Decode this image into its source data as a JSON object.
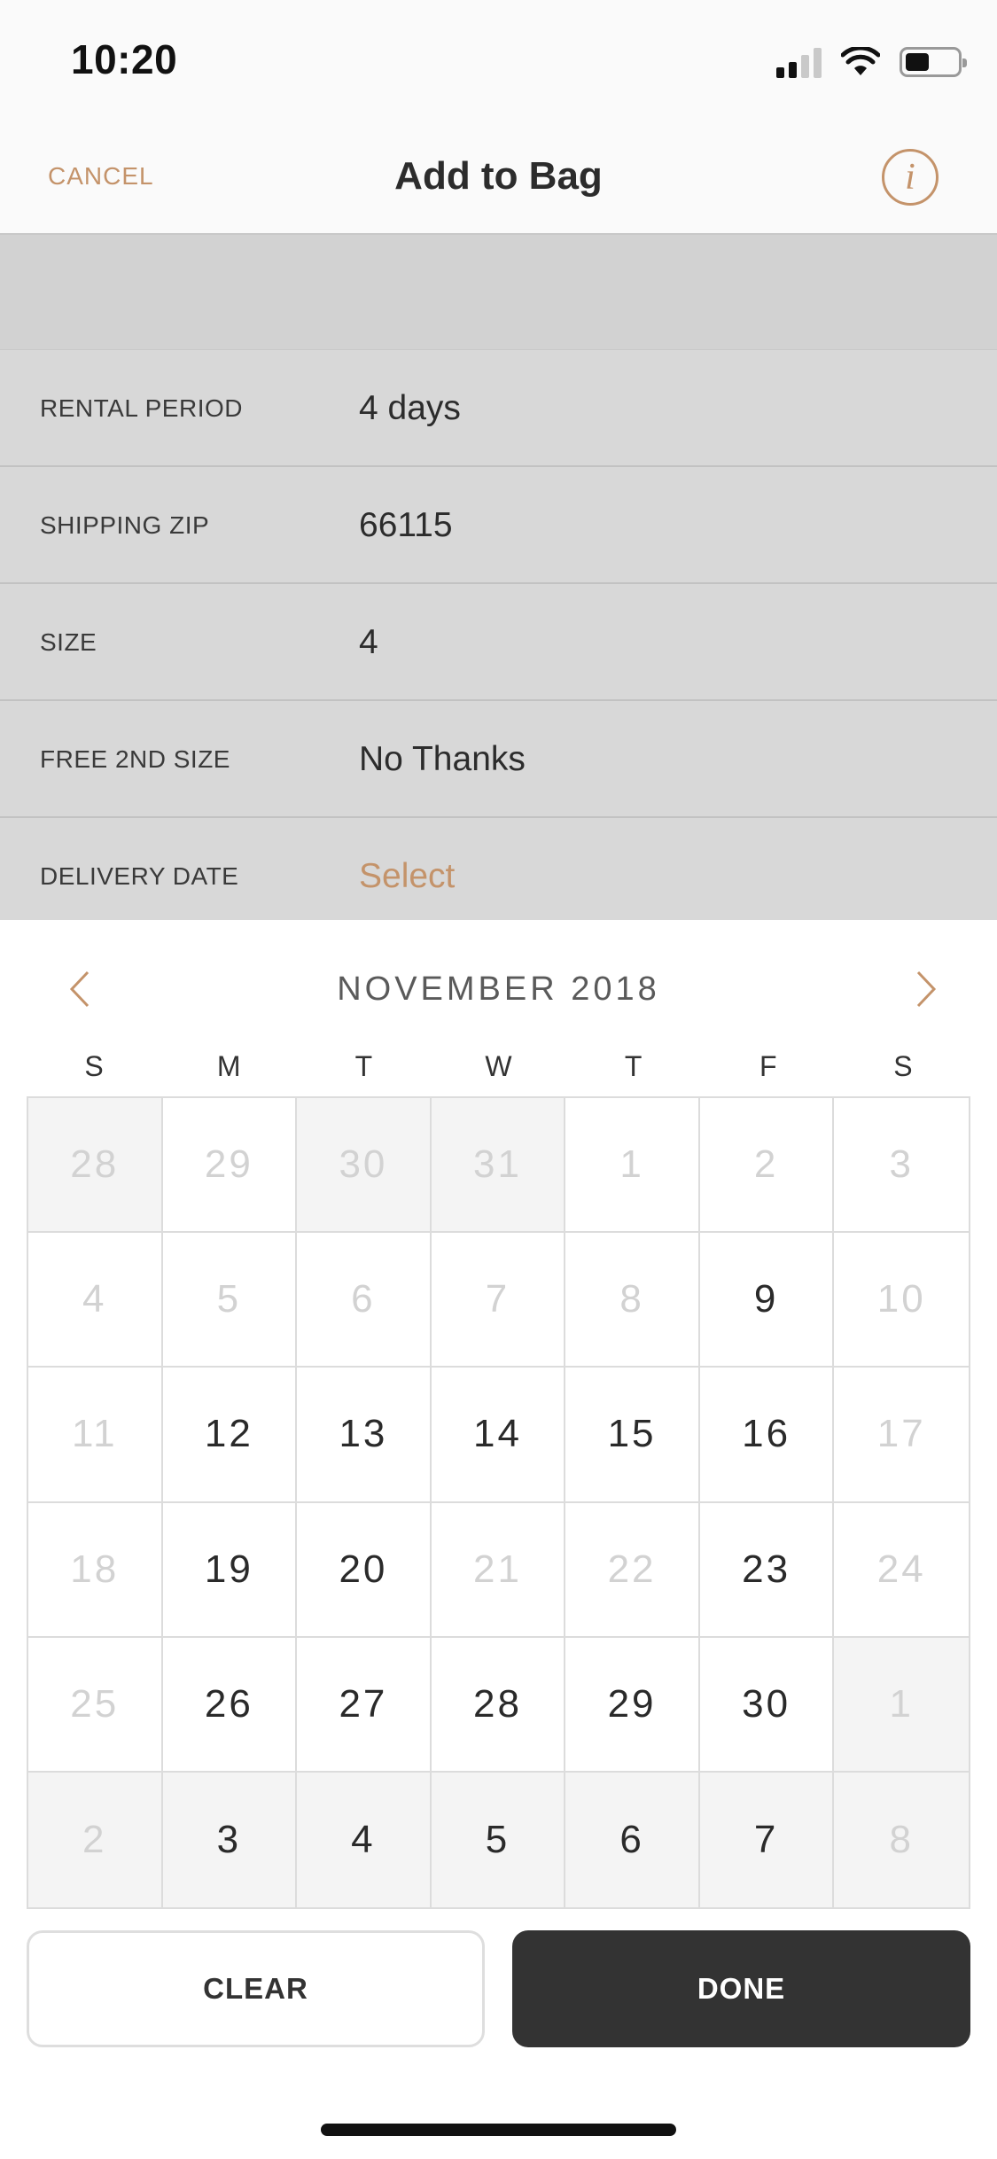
{
  "status_bar": {
    "time": "10:20",
    "battery_level": 0.45
  },
  "nav": {
    "cancel_label": "CANCEL",
    "title": "Add to Bag",
    "info_icon": "info-icon"
  },
  "options": [
    {
      "label": "RENTAL PERIOD",
      "value": "4 days"
    },
    {
      "label": "SHIPPING ZIP",
      "value": "66115"
    },
    {
      "label": "SIZE",
      "value": "4"
    },
    {
      "label": "FREE 2ND SIZE",
      "value": "No Thanks"
    },
    {
      "label": "DELIVERY DATE",
      "value": "Select"
    }
  ],
  "calendar": {
    "month_label": "NOVEMBER 2018",
    "weekdays": [
      "S",
      "M",
      "T",
      "W",
      "T",
      "F",
      "S"
    ],
    "days": [
      {
        "d": "28",
        "other": true,
        "avail": false
      },
      {
        "d": "29",
        "other": false,
        "avail": false
      },
      {
        "d": "30",
        "other": true,
        "avail": false
      },
      {
        "d": "31",
        "other": true,
        "avail": false
      },
      {
        "d": "1",
        "other": false,
        "avail": false
      },
      {
        "d": "2",
        "other": false,
        "avail": false
      },
      {
        "d": "3",
        "other": false,
        "avail": false
      },
      {
        "d": "4",
        "other": false,
        "avail": false
      },
      {
        "d": "5",
        "other": false,
        "avail": false
      },
      {
        "d": "6",
        "other": false,
        "avail": false
      },
      {
        "d": "7",
        "other": false,
        "avail": false
      },
      {
        "d": "8",
        "other": false,
        "avail": false
      },
      {
        "d": "9",
        "other": false,
        "avail": true
      },
      {
        "d": "10",
        "other": false,
        "avail": false
      },
      {
        "d": "11",
        "other": false,
        "avail": false
      },
      {
        "d": "12",
        "other": false,
        "avail": true
      },
      {
        "d": "13",
        "other": false,
        "avail": true
      },
      {
        "d": "14",
        "other": false,
        "avail": true
      },
      {
        "d": "15",
        "other": false,
        "avail": true
      },
      {
        "d": "16",
        "other": false,
        "avail": true
      },
      {
        "d": "17",
        "other": false,
        "avail": false
      },
      {
        "d": "18",
        "other": false,
        "avail": false
      },
      {
        "d": "19",
        "other": false,
        "avail": true
      },
      {
        "d": "20",
        "other": false,
        "avail": true
      },
      {
        "d": "21",
        "other": false,
        "avail": false
      },
      {
        "d": "22",
        "other": false,
        "avail": false
      },
      {
        "d": "23",
        "other": false,
        "avail": true
      },
      {
        "d": "24",
        "other": false,
        "avail": false
      },
      {
        "d": "25",
        "other": false,
        "avail": false
      },
      {
        "d": "26",
        "other": false,
        "avail": true
      },
      {
        "d": "27",
        "other": false,
        "avail": true
      },
      {
        "d": "28",
        "other": false,
        "avail": true
      },
      {
        "d": "29",
        "other": false,
        "avail": true
      },
      {
        "d": "30",
        "other": false,
        "avail": true
      },
      {
        "d": "1",
        "other": true,
        "avail": false
      },
      {
        "d": "2",
        "other": true,
        "avail": false
      },
      {
        "d": "3",
        "other": true,
        "avail": true
      },
      {
        "d": "4",
        "other": true,
        "avail": true
      },
      {
        "d": "5",
        "other": true,
        "avail": true
      },
      {
        "d": "6",
        "other": true,
        "avail": true
      },
      {
        "d": "7",
        "other": true,
        "avail": true
      },
      {
        "d": "8",
        "other": true,
        "avail": false
      }
    ]
  },
  "buttons": {
    "clear_label": "CLEAR",
    "done_label": "DONE"
  },
  "colors": {
    "accent": "#c4936a",
    "done_bg": "#333333",
    "overlay": "#d8d8d8"
  }
}
